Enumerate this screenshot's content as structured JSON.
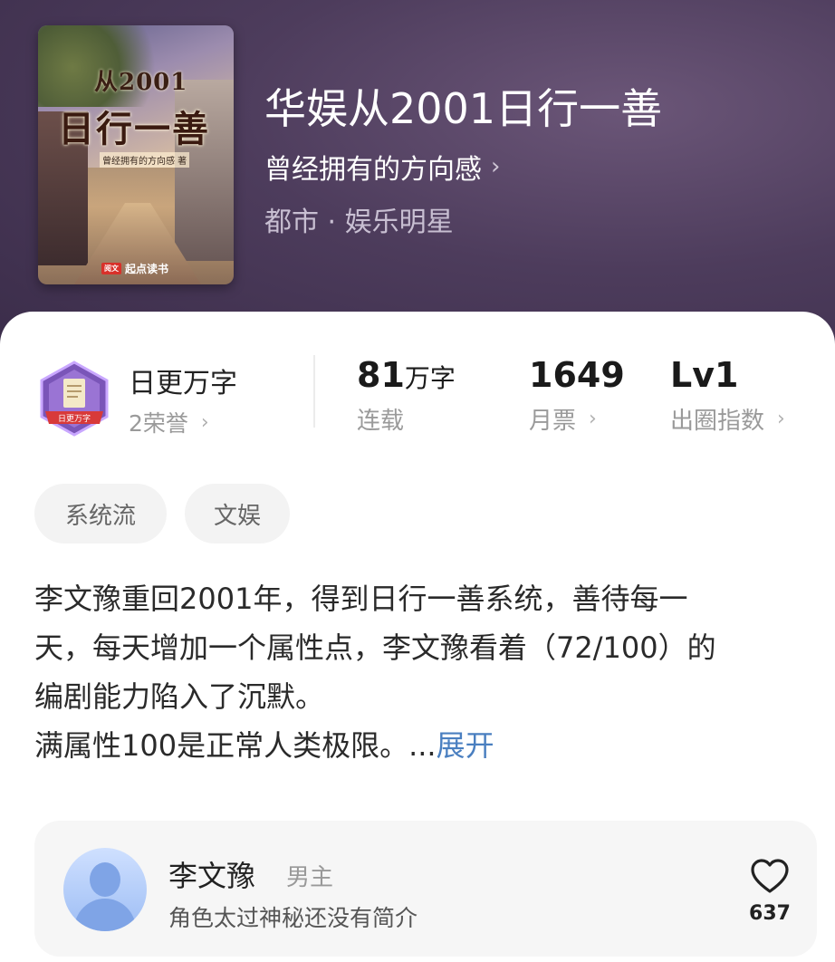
{
  "book": {
    "title": "华娱从2001日行一善",
    "author": "曾经拥有的方向感",
    "genre": "都市 · 娱乐明星",
    "cover": {
      "year_text": "从2001",
      "title_text": "日行一善",
      "subtitle_text": "曾经拥有的方向感 著",
      "brand_logo": "阅文",
      "brand_name": "起点读书"
    }
  },
  "honor": {
    "badge_text": "日更万字",
    "title": "日更万字",
    "sub": "2荣誉",
    "badge_color": "#7a55b8"
  },
  "stats": [
    {
      "value": "81",
      "unit": "万字",
      "label": "连载"
    },
    {
      "value": "1649",
      "unit": "",
      "label": "月票"
    },
    {
      "value": "Lv1",
      "unit": "",
      "label": "出圈指数"
    }
  ],
  "tags": [
    "系统流",
    "文娱"
  ],
  "description": {
    "lines": [
      "李文豫重回2001年，得到日行一善系统，善待每一",
      "天，每天增加一个属性点，李文豫看着（72/100）的",
      "编剧能力陷入了沉默。",
      "满属性100是正常人类极限。..."
    ],
    "expand_label": "展开",
    "link_color": "#4a7fc0"
  },
  "character": {
    "name": "李文豫",
    "role": "男主",
    "desc": "角色太过神秘还没有简介",
    "likes": "637"
  },
  "icons": {
    "chevron": "›",
    "heart": "heart-icon"
  }
}
